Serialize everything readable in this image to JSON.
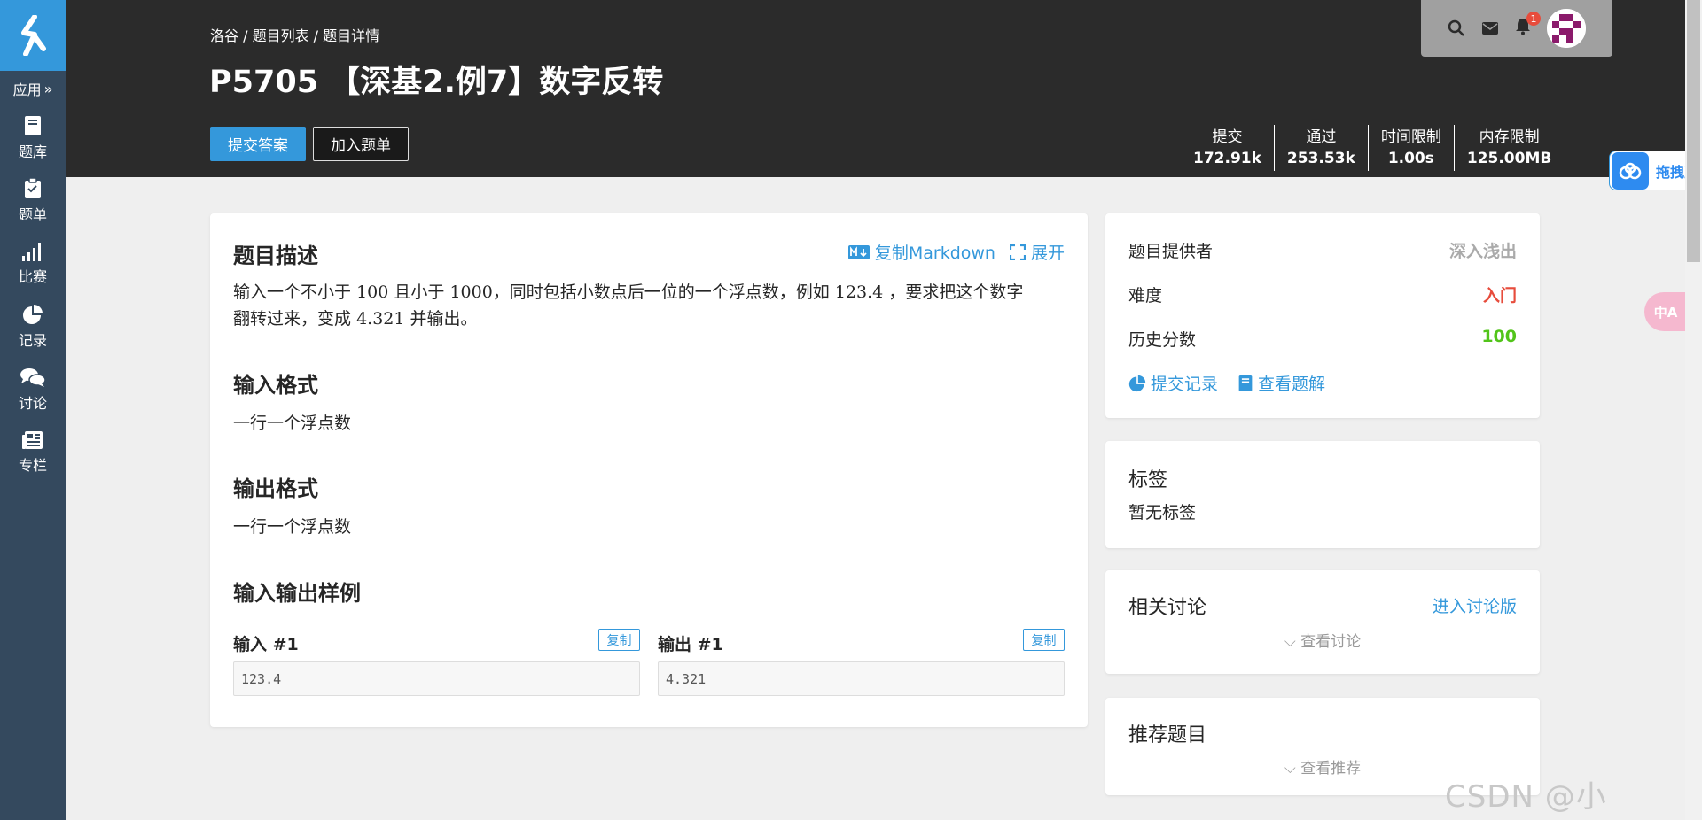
{
  "nav": {
    "apps_label": "应用",
    "items": [
      {
        "label": "题库",
        "icon": "book-icon"
      },
      {
        "label": "题单",
        "icon": "clipboard-icon"
      },
      {
        "label": "比赛",
        "icon": "signal-bars-icon"
      },
      {
        "label": "记录",
        "icon": "pie-chart-icon"
      },
      {
        "label": "讨论",
        "icon": "comments-icon"
      },
      {
        "label": "专栏",
        "icon": "newspaper-icon"
      }
    ]
  },
  "header": {
    "breadcrumb": "洛谷 / 题目列表 / 题目详情",
    "title": "P5705 【深基2.例7】数字反转",
    "submit_label": "提交答案",
    "add_label": "加入题单",
    "notification_count": "1",
    "stats": [
      {
        "label": "提交",
        "value": "172.91k"
      },
      {
        "label": "通过",
        "value": "253.53k"
      },
      {
        "label": "时间限制",
        "value": "1.00s"
      },
      {
        "label": "内存限制",
        "value": "125.00MB"
      }
    ]
  },
  "problem": {
    "desc_heading": "题目描述",
    "copy_md_label": "复制Markdown",
    "expand_label": "展开",
    "desc_p1": "输入一个不小于",
    "num_100": "100",
    "desc_p2": "且小于",
    "num_1000": "1000",
    "desc_p3": "，同时包括小数点后一位的一个浮点数，例如",
    "num_1234": "123.4",
    "desc_p4": "，要求把这个数字",
    "desc_p5": "翻转过来，变成",
    "num_4321": "4.321",
    "desc_p6": "并输出。",
    "input_heading": "输入格式",
    "input_text": "一行一个浮点数",
    "output_heading": "输出格式",
    "output_text": "一行一个浮点数",
    "samples_heading": "输入输出样例",
    "sample_in_label": "输入 #1",
    "sample_out_label": "输出 #1",
    "copy_label": "复制",
    "sample_in": "123.4",
    "sample_out": "4.321"
  },
  "info": {
    "provider_label": "题目提供者",
    "provider_value": "深入浅出",
    "difficulty_label": "难度",
    "difficulty_value": "入门",
    "history_label": "历史分数",
    "history_value": "100",
    "records_link": "提交记录",
    "solutions_link": "查看题解"
  },
  "tags": {
    "heading": "标签",
    "empty": "暂无标签"
  },
  "discuss": {
    "heading": "相关讨论",
    "enter": "进入讨论版",
    "view": "查看讨论"
  },
  "recommend": {
    "heading": "推荐题目",
    "view": "查看推荐"
  },
  "floating": {
    "baidu_label": "拖拽至",
    "translate_label": "中A"
  },
  "watermark": "CSDN @小",
  "colors": {
    "accent": "#3498db",
    "difficulty": "#e74c3c",
    "score": "#52c41a",
    "nav_bg": "#34495e",
    "header_bg": "#2b2b2b"
  }
}
